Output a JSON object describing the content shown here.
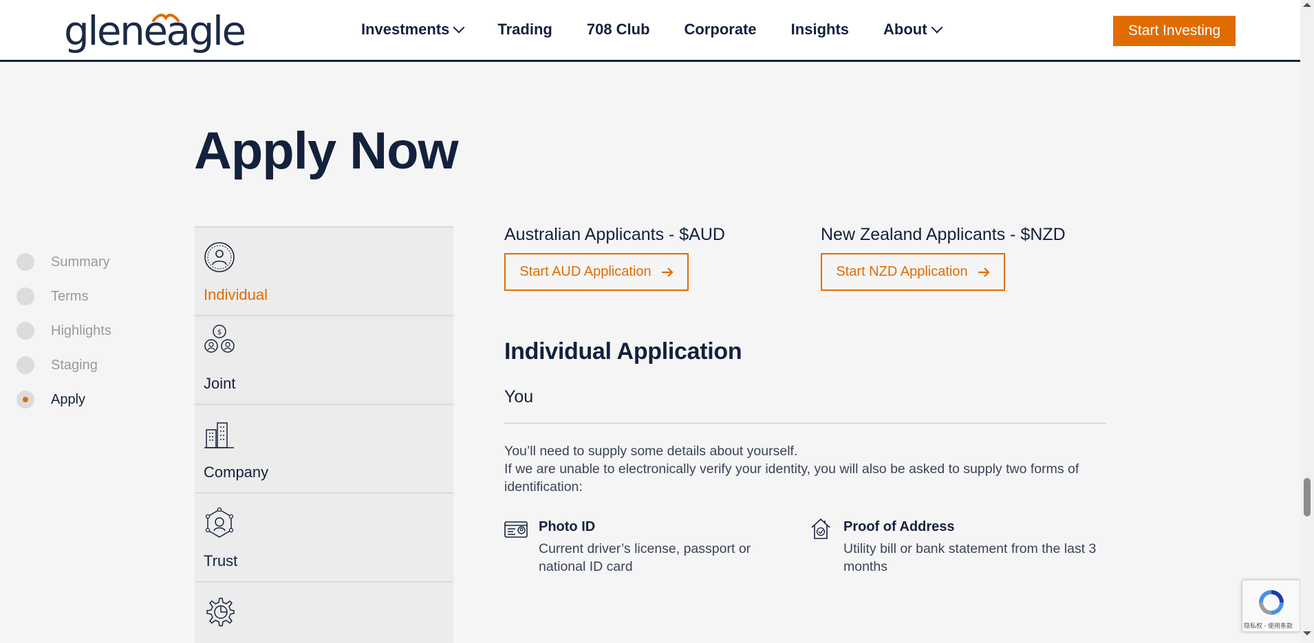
{
  "header": {
    "logo": "gleneagle",
    "nav": [
      {
        "label": "Investments",
        "has_dropdown": true
      },
      {
        "label": "Trading",
        "has_dropdown": false
      },
      {
        "label": "708 Club",
        "has_dropdown": false
      },
      {
        "label": "Corporate",
        "has_dropdown": false
      },
      {
        "label": "Insights",
        "has_dropdown": false
      },
      {
        "label": "About",
        "has_dropdown": true
      }
    ],
    "cta_label": "Start Investing"
  },
  "page": {
    "title": "Apply Now"
  },
  "steps": [
    {
      "label": "Summary",
      "active": false
    },
    {
      "label": "Terms",
      "active": false
    },
    {
      "label": "Highlights",
      "active": false
    },
    {
      "label": "Staging",
      "active": false
    },
    {
      "label": "Apply",
      "active": true
    }
  ],
  "applicant_types": [
    {
      "label": "Individual",
      "icon": "person-circle-icon",
      "active": true
    },
    {
      "label": "Joint",
      "icon": "joint-people-icon",
      "active": false
    },
    {
      "label": "Company",
      "icon": "buildings-icon",
      "active": false
    },
    {
      "label": "Trust",
      "icon": "network-people-icon",
      "active": false
    },
    {
      "label": "",
      "icon": "gear-chart-icon",
      "active": false
    }
  ],
  "applications": {
    "aud": {
      "heading": "Australian Applicants - $AUD",
      "button": "Start AUD Application",
      "icon": "arrow-right-icon"
    },
    "nzd": {
      "heading": "New Zealand Applicants - $NZD",
      "button": "Start NZD Application",
      "icon": "arrow-right-icon"
    }
  },
  "individual": {
    "heading": "Individual Application",
    "subheading": "You",
    "line1": "You’ll need to supply some details about yourself.",
    "line2": "If we are unable to electronically verify your identity, you will also be asked to supply two forms of identification:",
    "requirements": [
      {
        "title": "Photo ID",
        "text": "Current driver’s license, passport or national ID card",
        "icon": "id-card-icon"
      },
      {
        "title": "Proof of Address",
        "text": "Utility bill or bank statement from the last 3 months",
        "icon": "house-check-icon"
      }
    ]
  },
  "recaptcha": {
    "text": "隐私权 - 使用条款"
  },
  "colors": {
    "accent": "#e06c00",
    "navy": "#14213d",
    "background": "#f5f5f5"
  }
}
